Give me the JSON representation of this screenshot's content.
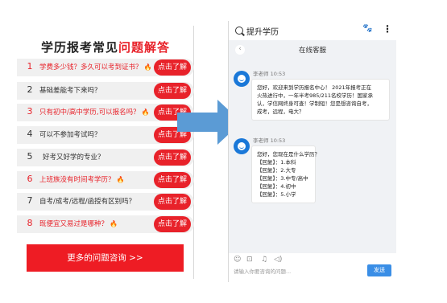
{
  "left": {
    "title_main": "学历报考常见",
    "title_accent": "问题解答",
    "items": [
      {
        "num": "1",
        "question": "学费多少钱？多久可以考到证书？",
        "hot": true,
        "red": true,
        "button": "点击了解"
      },
      {
        "num": "2",
        "question": "基础差能考下来吗？",
        "hot": false,
        "red": false,
        "button": "点击了解"
      },
      {
        "num": "3",
        "question": "只有初中/高中学历,可以报名吗？",
        "hot": true,
        "red": true,
        "button": "点击了解"
      },
      {
        "num": "4",
        "question": "可以不参加考试吗？",
        "hot": false,
        "red": false,
        "button": "点击了解"
      },
      {
        "num": "5",
        "question": "好考又好学的专业？",
        "hot": false,
        "red": false,
        "button": "点击了解"
      },
      {
        "num": "6",
        "question": "上班族没有时间考学历？",
        "hot": true,
        "red": true,
        "button": "点击了解"
      },
      {
        "num": "7",
        "question": "自考/成考/远程/函授有区别吗？",
        "hot": false,
        "red": false,
        "button": "点击了解"
      },
      {
        "num": "8",
        "question": "既便宜又易过是哪种？",
        "hot": true,
        "red": true,
        "button": "点击了解"
      }
    ],
    "fire_glyph": "🔥",
    "more_button": "更多的问题咨询 >>"
  },
  "right": {
    "app_title": "提升学历",
    "paw_glyph": "🐾",
    "more_glyph": "⋮",
    "chat_title": "在线客服",
    "back_glyph": "‹",
    "messages": [
      {
        "sender": "李老师  10:53",
        "lines": [
          "您好，欢迎来到学历报名中心！ 2021年报考正在",
          "火热进行中，一年半考985/211名校学历！国家承",
          "认，学信网终身可查！学制短！您是想咨询自考，",
          "成考，远程，电大？"
        ]
      },
      {
        "sender": "李老师  10:53",
        "lines": [
          "您好，您现在是什么学历？",
          "【回复】：1.本科",
          "【回复】：2.大专",
          "【回复】：3.中专/高中",
          "【回复】：4.初中",
          "【回复】：5.小学"
        ]
      }
    ],
    "tools": [
      "☺",
      "⊡",
      "♫",
      "◁)"
    ],
    "input_placeholder": "请输入你要咨询的问题...",
    "send_button": "发送"
  },
  "colors": {
    "accent_red": "#e8222a",
    "arrow_blue": "#5b9bd5",
    "avatar_blue": "#1a78d8",
    "send_blue": "#3a8ee6"
  }
}
